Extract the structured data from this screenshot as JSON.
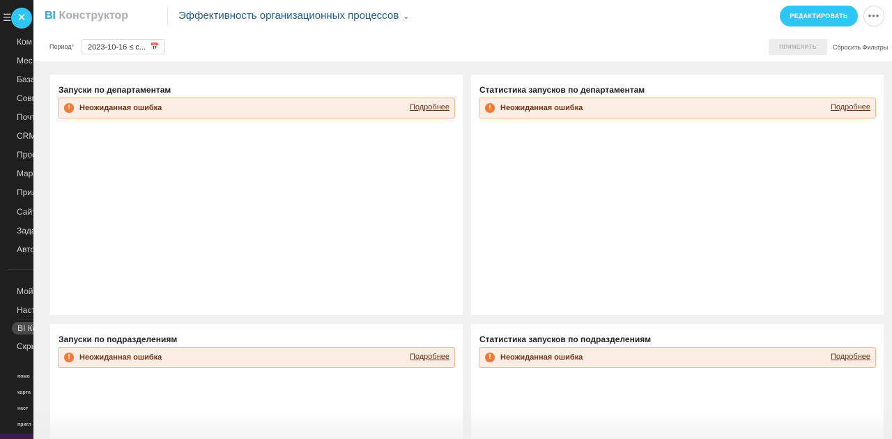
{
  "sidebar": {
    "items": [
      "Ком",
      "Мес",
      "База",
      "Совм",
      "Почт",
      "CRM",
      "Проо",
      "Map",
      "Прил",
      "Сайт",
      "Зада",
      "Авто",
      "Мой",
      "Наст",
      "BI Ко",
      "Скрь"
    ],
    "footer_items": [
      "помо",
      "карта",
      "наст",
      "пригл"
    ]
  },
  "header": {
    "brand_bi": "BI",
    "brand_name": "Конструктор",
    "dashboard_title": "Эффективность организационных процессов",
    "edit_label": "РЕДАКТИРОВАТЬ",
    "more_label": "•••",
    "close_label": "✕"
  },
  "filters": {
    "period_label": "Период",
    "required_mark": "*",
    "period_value": "2023-10-16 ≤ c...",
    "apply_label": "ПРИМЕНИТЬ",
    "reset_label": "Сбросить Фильтры"
  },
  "widgets": [
    {
      "title": "Запуски по департаментам",
      "error": "Неожиданная ошибка",
      "link": "Подробнее"
    },
    {
      "title": "Статистика запусков по департаментам",
      "error": "Неожиданная ошибка",
      "link": "Подробнее"
    },
    {
      "title": "Запуски по подразделениям",
      "error": "Неожиданная ошибка",
      "link": "Подробнее"
    },
    {
      "title": "Статистика запусков по подразделениям",
      "error": "Неожиданная ошибка",
      "link": "Подробнее"
    }
  ],
  "colors": {
    "accent": "#2fc6f6",
    "error_bg": "#fdeee5",
    "error_border": "#f3b796",
    "error_icon": "#f07b39",
    "title_blue": "#1f5d8c"
  }
}
